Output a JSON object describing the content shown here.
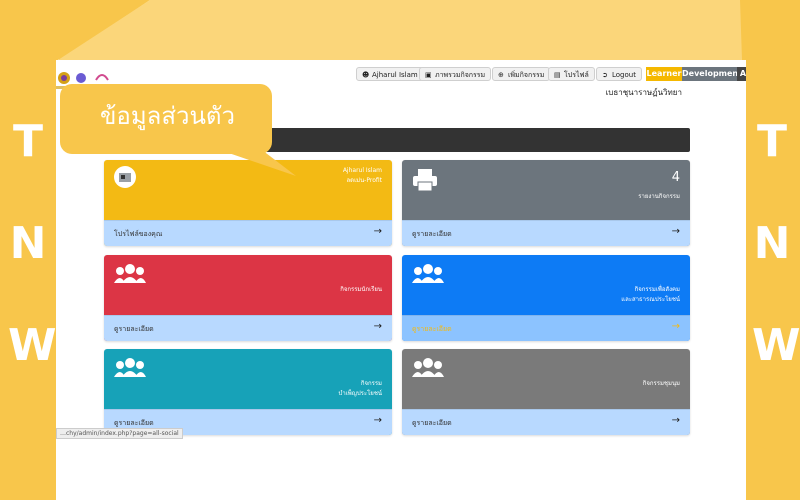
{
  "colors": {
    "frame": "#f8c64b",
    "card_yellow": "#f3ba14",
    "card_grey": "#6c757d",
    "card_red": "#dc3545",
    "card_blue": "#0d7bf5",
    "card_teal": "#17a2b8",
    "card_grey2": "#7a7a7a",
    "card_footer": "#b8d9ff"
  },
  "side_letters": [
    "T",
    "N",
    "W"
  ],
  "callout": {
    "text": "ข้อมูลส่วนตัว"
  },
  "topbar": {
    "buttons": [
      {
        "icon": "user-icon",
        "label": "Ajharul Islam"
      },
      {
        "icon": "image-icon",
        "label": "ภาพรวมกิจกรรม"
      },
      {
        "icon": "plus-circle-icon",
        "label": "เพิ่มกิจกรรม"
      },
      {
        "icon": "id-card-icon",
        "label": "โปรไฟล์"
      },
      {
        "icon": "logout-icon",
        "label": "Logout"
      }
    ],
    "tabs": [
      {
        "label": "Learner",
        "color": "#f5b800"
      },
      {
        "label": "Development",
        "color": "#6c757d"
      },
      {
        "label": "A",
        "color": "#444444"
      }
    ],
    "school_name": "เบธาชุนาราษฏ์นวิทยา"
  },
  "cards": [
    {
      "name": "profile",
      "line1": "Ajharul Islam",
      "line2": "ลดเม่น-Profit",
      "footer": "โปรไฟล์ของคุณ",
      "icon": "avatar"
    },
    {
      "name": "report",
      "count": "4",
      "line1": "รายงานกิจกรรม",
      "footer": "ดูรายละเอียด",
      "icon": "printer-icon"
    },
    {
      "name": "club",
      "line1": "กิจกรรมนักเรียนทั่วไป",
      "line2": "กิจกรรมนักเรียน",
      "footer": "ดูรายละเอียด",
      "icon": "users-icon"
    },
    {
      "name": "social",
      "line1": "กิจกรรมเพื่อสังคม",
      "line2": "และสาธารณประโยชน์",
      "footer": "ดูรายละเอียด",
      "icon": "users-icon"
    },
    {
      "name": "public",
      "line1": "กิจกรรม",
      "line2": "บำเพ็ญประโยชน์",
      "footer": "ดูรายละเอียด",
      "icon": "users-icon"
    },
    {
      "name": "scout",
      "line1": "กิจกรรมชุมนุม",
      "footer": "ดูรายละเอียด",
      "icon": "users-icon"
    }
  ],
  "status_url": "…chy/admin/index.php?page=all-social"
}
